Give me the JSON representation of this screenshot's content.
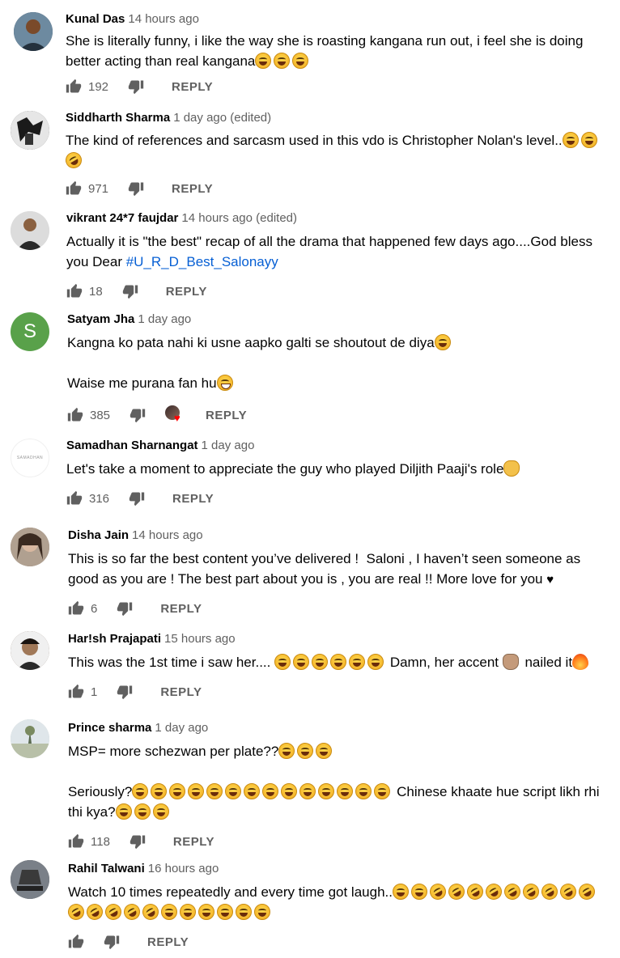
{
  "labels": {
    "reply": "REPLY"
  },
  "icons": {
    "like": "thumb-up-icon",
    "dislike": "thumb-down-icon",
    "creator_heart": "creator-heart-icon"
  },
  "colors": {
    "author": "#030303",
    "meta": "#606060",
    "hashtag": "#065fd4",
    "heart": "#ff0000"
  },
  "comments": [
    {
      "author": "Kunal Das",
      "time": "14 hours ago",
      "text_parts": [
        "She is literally funny, i like the way she is roasting kangana run out, i feel she is doing\nbetter acting than real kangana"
      ],
      "likes": "192",
      "avatar_color": "#3b4a5a"
    },
    {
      "author": "Siddharth Sharma",
      "time": "1 day ago (edited)",
      "text_parts": [
        "The kind of references and sarcasm used in this vdo is Christopher Nolan's level.."
      ],
      "likes": "971",
      "avatar_color": "#2b2b2b"
    },
    {
      "author": "vikrant 24*7 faujdar",
      "time": "14 hours ago (edited)",
      "text_parts": [
        "Actually it is \"the best\" recap of all the drama that happened few days ago....God bless\nyou Dear "
      ],
      "hashtag": "#U_R_D_Best_Salonayy",
      "likes": "18",
      "avatar_color": "#d8d8d8"
    },
    {
      "author": "Satyam Jha",
      "time": "1 day ago",
      "text_parts": [
        "Kangna ko pata nahi ki usne aapko galti se shoutout de diya",
        "\n\nWaise me purana fan hu"
      ],
      "likes": "385",
      "avatar_letter": "S",
      "avatar_color": "#59a14a"
    },
    {
      "author": "Samadhan Sharnangat",
      "time": "1 day ago",
      "text_parts": [
        "Let's take a moment to appreciate the guy who played Diljith Paaji's role"
      ],
      "likes": "316",
      "avatar_text": "SAMADHAN",
      "avatar_color": "#ffffff"
    },
    {
      "author": "Disha Jain",
      "time": "14 hours ago",
      "text_parts": [
        "This is so far the best content you’ve delivered !  Saloni , I haven’t seen someone as\ngood as you are ! The best part about you is , you are real !! More love for you "
      ],
      "heart_glyph": "♥",
      "likes": "6",
      "avatar_color": "#8a7a6a"
    },
    {
      "author": "Har!sh Prajapati",
      "time": "15 hours ago",
      "text_parts": [
        "This was the 1st time i saw her.... ",
        " Damn, her accent ",
        " nailed it"
      ],
      "likes": "1",
      "avatar_color": "#5a4030"
    },
    {
      "author": "Prince sharma",
      "time": "1 day ago",
      "text_parts": [
        "MSP= more schezwan per plate??",
        "\n\nSeriously?",
        " Chinese khaate hue script likh rhi\nthi kya?"
      ],
      "likes": "118",
      "avatar_color": "#b8c8c0"
    },
    {
      "author": "Rahil Talwani",
      "time": "16 hours ago",
      "text_parts": [
        "Watch 10 times repeatedly and every time got laugh.."
      ],
      "likes": "",
      "avatar_color": "#4a4a4a"
    }
  ]
}
